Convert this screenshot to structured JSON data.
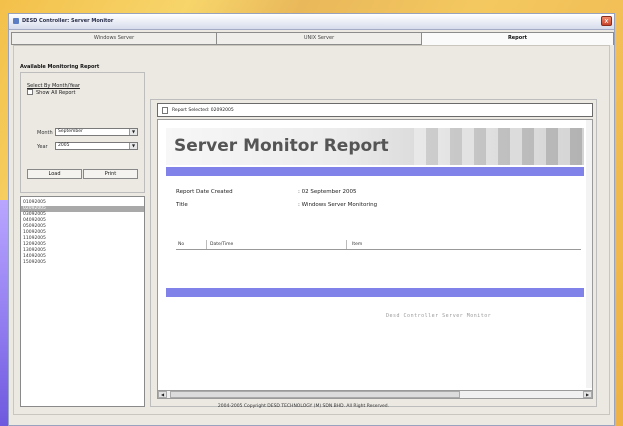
{
  "window": {
    "title": "DESD Controller: Server Monitor",
    "close_glyph": "x"
  },
  "tabs": [
    {
      "label": "Windows Server"
    },
    {
      "label": "UNIX Server"
    },
    {
      "label": "Report"
    }
  ],
  "left": {
    "section_title": "Available Monitoring Report",
    "select_link": "Select By Month/Year",
    "show_all_label": "Show All Report",
    "month_label": "Month",
    "month_value": "September",
    "year_label": "Year",
    "year_value": "2005",
    "load_button": "Load",
    "print_button": "Print",
    "reports": [
      "01092005",
      "02092005",
      "03092005",
      "04092005",
      "05092005",
      "10092005",
      "11092005",
      "12092005",
      "13092005",
      "14092005",
      "15092005"
    ]
  },
  "report": {
    "selected_text": "Report Selected: 02092005",
    "banner_title": "Server Monitor Report",
    "date_label": "Report Date Created",
    "date_value": ": 02 September 2005",
    "title_label": "Title",
    "title_value": ": Windows Server Monitoring",
    "col_no": "No",
    "col_datetime": "Date/Time",
    "col_item": "Item",
    "footer_signature": "Desd Controller Server Monitor"
  },
  "status": {
    "copyright": "2004-2005 Copyright DESD TECHNOLOGY (M) SDN BHD. All Right Reserved."
  }
}
